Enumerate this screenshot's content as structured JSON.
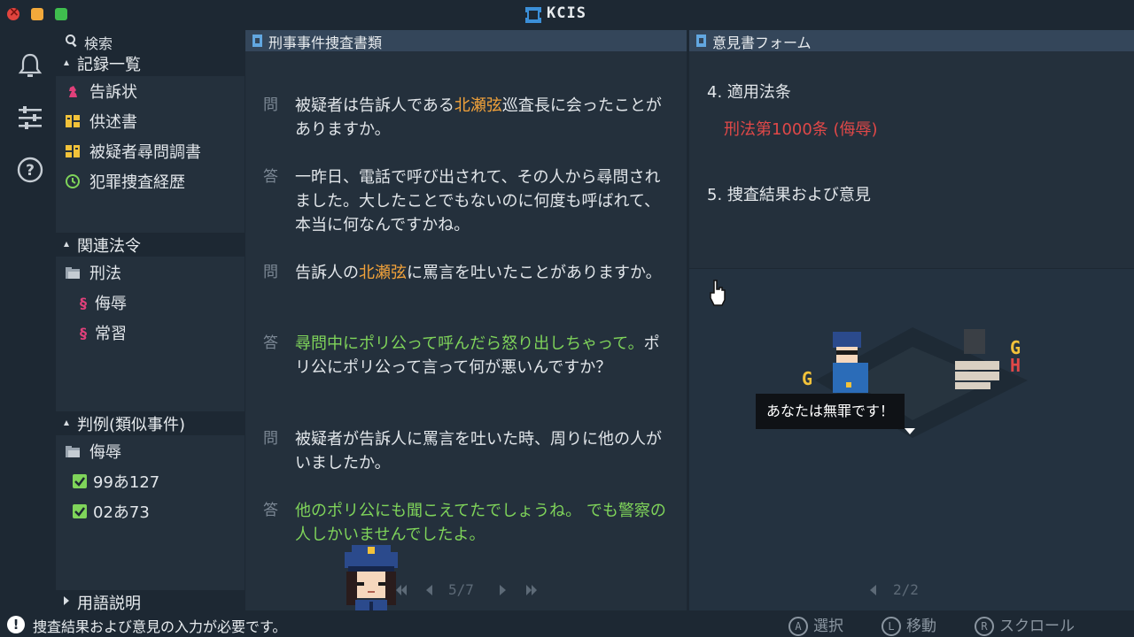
{
  "app": {
    "title": "KCIS"
  },
  "search": {
    "label": "検索"
  },
  "sidebar": {
    "records": {
      "title": "記録一覧",
      "items": [
        {
          "label": "告訴状",
          "icon": "chess-knight-icon"
        },
        {
          "label": "供述書",
          "icon": "statement-icon"
        },
        {
          "label": "被疑者尋問調書",
          "icon": "interrogation-icon"
        },
        {
          "label": "犯罪捜査経歴",
          "icon": "history-icon"
        }
      ]
    },
    "laws": {
      "title": "関連法令",
      "folder": "刑法",
      "items": [
        {
          "label": "侮辱"
        },
        {
          "label": "常習"
        }
      ]
    },
    "precedents": {
      "title": "判例(類似事件)",
      "folder": "侮辱",
      "items": [
        {
          "label": "99あ127"
        },
        {
          "label": "02あ73"
        }
      ]
    },
    "glossary": {
      "title": "用語説明"
    }
  },
  "middle": {
    "title": "刑事事件捜査書類",
    "qa": [
      {
        "mark": "問",
        "parts": [
          "被疑者は告訴人である",
          "北瀬弦",
          "巡査長に会ったことがありますか。"
        ]
      },
      {
        "mark": "答",
        "text": "一昨日、電話で呼び出されて、その人から尋問されました。大したことでもないのに何度も呼ばれて、本当に何なんですかね。"
      },
      {
        "mark": "問",
        "parts": [
          "告訴人の",
          "北瀬弦",
          "に罵言を吐いたことがありますか。"
        ]
      },
      {
        "mark": "答",
        "parts": [
          "尋問中にポリ公って呼んだら怒り出しちゃって。",
          "ポリ公にポリ公って言って何が悪いんですか？"
        ]
      },
      {
        "mark": "問",
        "text": "被疑者が告訴人に罵言を吐いた時、周りに他の人がいましたか。"
      },
      {
        "mark": "答",
        "text": "他のポリ公にも聞こえてたでしょうね。 でも警察の人しかいませんでしたよ。"
      }
    ],
    "pager": "5/7"
  },
  "right": {
    "title": "意見書フォーム",
    "section4": "4. 適用法条",
    "law": "刑法第1000条 (侮辱)",
    "section5": "5. 捜査結果および意見",
    "speech": "あなたは無罪です！",
    "pager": "2/2"
  },
  "status": {
    "message": "捜査結果および意見の入力が必要です。",
    "hints": [
      {
        "key": "A",
        "label": "選択"
      },
      {
        "key": "L",
        "label": "移動"
      },
      {
        "key": "R",
        "label": "スクロール"
      }
    ]
  },
  "colors": {
    "highlight": "#f2a23a",
    "green": "#7fd45a",
    "red": "#e04848",
    "panel": "#24303c",
    "header": "#34465a"
  }
}
